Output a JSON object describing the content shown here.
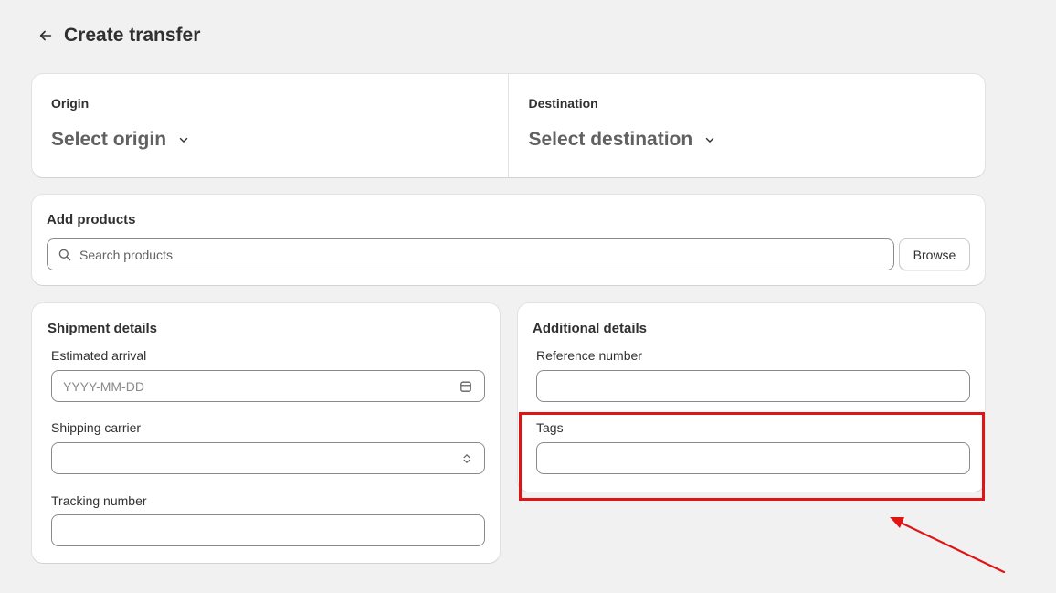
{
  "header": {
    "title": "Create transfer",
    "back_icon": "arrow-left-icon"
  },
  "origin": {
    "label": "Origin",
    "select_text": "Select origin"
  },
  "destination": {
    "label": "Destination",
    "select_text": "Select destination"
  },
  "products": {
    "title": "Add products",
    "search_placeholder": "Search products",
    "browse_label": "Browse"
  },
  "shipment": {
    "title": "Shipment details",
    "estimated_arrival_label": "Estimated arrival",
    "estimated_arrival_placeholder": "YYYY-MM-DD",
    "shipping_carrier_label": "Shipping carrier",
    "shipping_carrier_value": "",
    "tracking_number_label": "Tracking number",
    "tracking_number_value": ""
  },
  "additional": {
    "title": "Additional details",
    "reference_number_label": "Reference number",
    "reference_number_value": "",
    "tags_label": "Tags",
    "tags_value": ""
  },
  "annotation": {
    "highlight_color": "#e01414"
  }
}
